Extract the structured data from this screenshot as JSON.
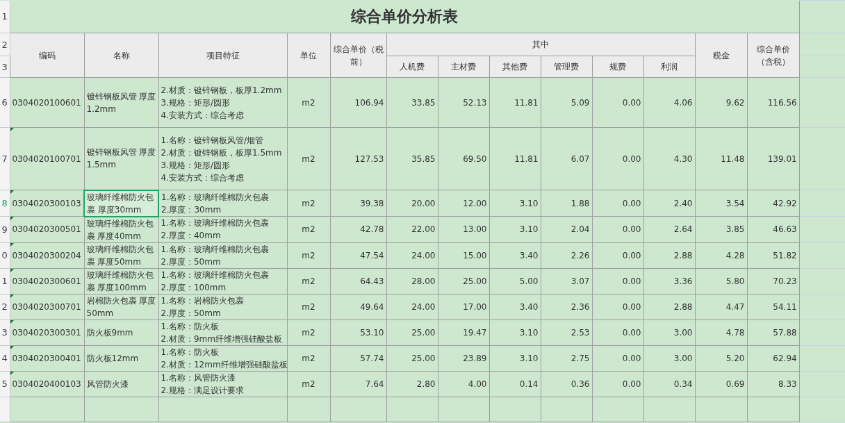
{
  "title": "综合单价分析表",
  "header_row_numbers": [
    "1",
    "2",
    "3"
  ],
  "header": {
    "main": [
      "编码",
      "名称",
      "项目特征",
      "单位",
      "综合单价（税前）"
    ],
    "group": "其中",
    "sub": [
      "人机费",
      "主材费",
      "其他费",
      "管理费",
      "规费",
      "利润"
    ],
    "tail": [
      "税金",
      "综合单价（含税）"
    ]
  },
  "rows": [
    {
      "number": "6",
      "code": "0304020100601",
      "name": "镀锌钢板风管 厚度1.2mm",
      "features": [
        "2.材质：镀锌钢板，板厚1.2mm",
        "3.规格：矩形/圆形",
        "4.安装方式：综合考虑"
      ],
      "unit": "m2",
      "values": [
        "106.94",
        "33.85",
        "52.13",
        "11.81",
        "5.09",
        "0.00",
        "4.06",
        "9.62",
        "116.56"
      ],
      "selected": false
    },
    {
      "number": "7",
      "code": "0304020100701",
      "name": "镀锌钢板风管 厚度1.5mm",
      "features": [
        "1.名称：镀锌钢板风管/烟管",
        "2.材质：镀锌钢板，板厚1.5mm",
        "3.规格：矩形/圆形",
        "4.安装方式：综合考虑"
      ],
      "unit": "m2",
      "values": [
        "127.53",
        "35.85",
        "69.50",
        "11.81",
        "6.07",
        "0.00",
        "4.30",
        "11.48",
        "139.01"
      ],
      "selected": false
    },
    {
      "number": "8",
      "code": "0304020300103",
      "name": "玻璃纤维棉防火包裹 厚度30mm",
      "features": [
        "1.名称：玻璃纤维棉防火包裹",
        "2.厚度：30mm"
      ],
      "unit": "m2",
      "values": [
        "39.38",
        "20.00",
        "12.00",
        "3.10",
        "1.88",
        "0.00",
        "2.40",
        "3.54",
        "42.92"
      ],
      "selected": true
    },
    {
      "number": "9",
      "code": "0304020300501",
      "name": "玻璃纤维棉防火包裹 厚度40mm",
      "features": [
        "1.名称：玻璃纤维棉防火包裹",
        "2.厚度：40mm"
      ],
      "unit": "m2",
      "values": [
        "42.78",
        "22.00",
        "13.00",
        "3.10",
        "2.04",
        "0.00",
        "2.64",
        "3.85",
        "46.63"
      ],
      "selected": false
    },
    {
      "number": "0",
      "code": "0304020300204",
      "name": "玻璃纤维棉防火包裹 厚度50mm",
      "features": [
        "1.名称：玻璃纤维棉防火包裹",
        "2.厚度：50mm"
      ],
      "unit": "m2",
      "values": [
        "47.54",
        "24.00",
        "15.00",
        "3.40",
        "2.26",
        "0.00",
        "2.88",
        "4.28",
        "51.82"
      ],
      "selected": false
    },
    {
      "number": "1",
      "code": "0304020300601",
      "name": "玻璃纤维棉防火包裹 厚度100mm",
      "features": [
        "1.名称：玻璃纤维棉防火包裹",
        "2.厚度：100mm"
      ],
      "unit": "m2",
      "values": [
        "64.43",
        "28.00",
        "25.00",
        "5.00",
        "3.07",
        "0.00",
        "3.36",
        "5.80",
        "70.23"
      ],
      "selected": false
    },
    {
      "number": "2",
      "code": "0304020300701",
      "name": "岩棉防火包裹 厚度50mm",
      "features": [
        "1.名称：岩棉防火包裹",
        "2.厚度：50mm"
      ],
      "unit": "m2",
      "values": [
        "49.64",
        "24.00",
        "17.00",
        "3.40",
        "2.36",
        "0.00",
        "2.88",
        "4.47",
        "54.11"
      ],
      "selected": false
    },
    {
      "number": "3",
      "code": "0304020300301",
      "name": "防火板9mm",
      "features": [
        "1.名称：防火板",
        "2.材质：9mm纤维增强硅酸盐板"
      ],
      "unit": "m2",
      "values": [
        "53.10",
        "25.00",
        "19.47",
        "3.10",
        "2.53",
        "0.00",
        "3.00",
        "4.78",
        "57.88"
      ],
      "selected": false
    },
    {
      "number": "4",
      "code": "0304020300401",
      "name": "防火板12mm",
      "features": [
        "1.名称：防火板",
        "2.材质：12mm纤维增强硅酸盐板"
      ],
      "unit": "m2",
      "values": [
        "57.74",
        "25.00",
        "23.89",
        "3.10",
        "2.75",
        "0.00",
        "3.00",
        "5.20",
        "62.94"
      ],
      "selected": false
    },
    {
      "number": "5",
      "code": "0304020400103",
      "name": "风管防火漆",
      "features": [
        "1.名称：风管防火漆",
        "2.规格：满足设计要求"
      ],
      "unit": "m2",
      "values": [
        "7.64",
        "2.80",
        "4.00",
        "0.14",
        "0.36",
        "0.00",
        "0.34",
        "0.69",
        "8.33"
      ],
      "selected": false
    }
  ]
}
